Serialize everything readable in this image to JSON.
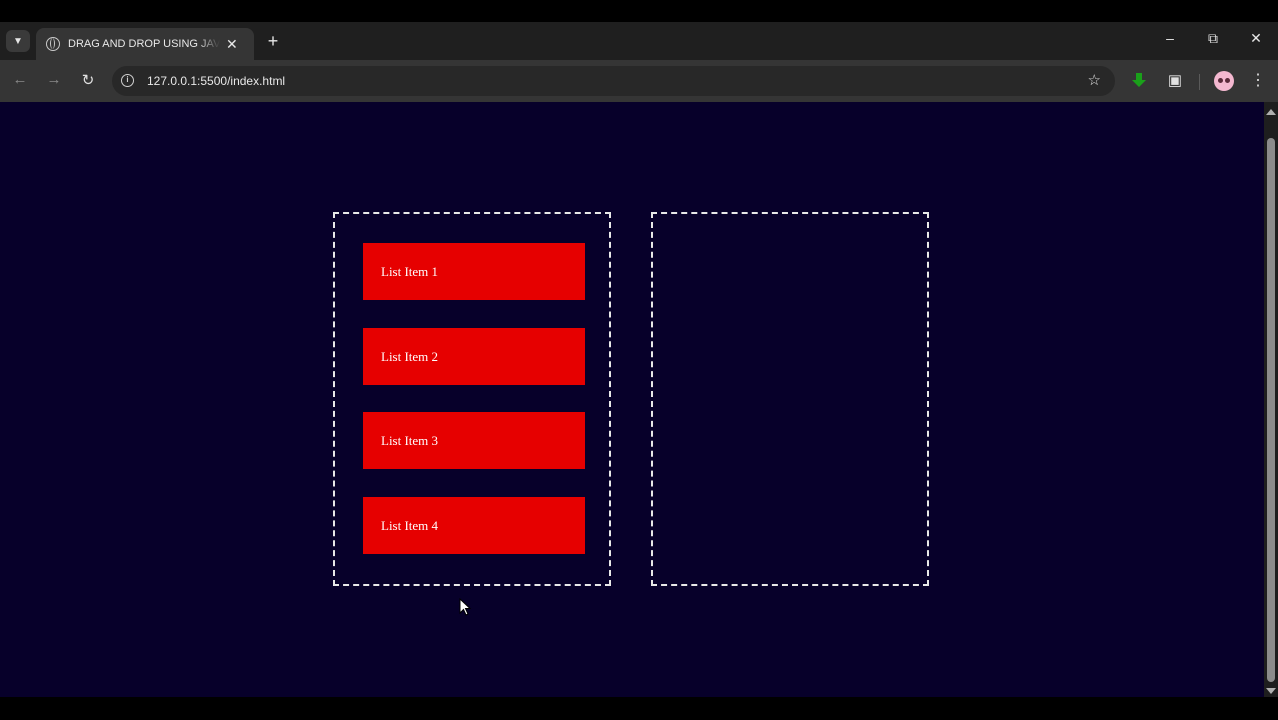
{
  "browser": {
    "tab_title": "DRAG AND DROP USING JAVASCRIPT",
    "url": "127.0.0.1:5500/index.html",
    "icons": {
      "tab_search": "chevron-down-icon",
      "tab_close": "close-icon",
      "new_tab": "plus-icon",
      "back": "arrow-left-icon",
      "forward": "arrow-right-icon",
      "reload": "reload-icon",
      "site_info": "info-icon",
      "bookmark": "star-icon",
      "download": "download-icon",
      "extensions": "puzzle-icon",
      "menu": "kebab-menu-icon"
    }
  },
  "page": {
    "background": "#07002a",
    "item_color": "#e60000",
    "left_list": {
      "items": [
        {
          "label": "List Item 1"
        },
        {
          "label": "List Item 2"
        },
        {
          "label": "List Item 3"
        },
        {
          "label": "List Item 4"
        }
      ]
    },
    "right_list": {
      "items": []
    }
  }
}
